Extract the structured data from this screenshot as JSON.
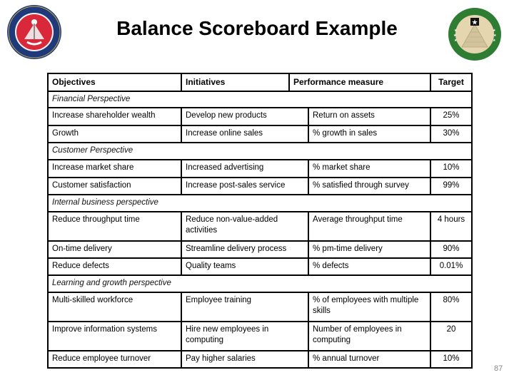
{
  "slide": {
    "title": "Balance Scoreboard Example",
    "page_number": "87",
    "left_logo": "office-of-the-assistant-secretary-of-the-army-seal",
    "right_logo": "united-states-army-financial-management-seal"
  },
  "colors": {
    "left_seal_outer": "#1f3a7a",
    "left_seal_inner": "#d8283a",
    "right_seal_outer": "#2e7d32",
    "right_seal_inner": "#e6d6b0"
  },
  "table": {
    "headers": {
      "objectives": "Objectives",
      "initiatives": "Initiatives",
      "performance_measure": "Performance measure",
      "target": "Target"
    },
    "sections": [
      {
        "title": "Financial Perspective",
        "rows": [
          {
            "objective": "Increase shareholder wealth",
            "initiative": "Develop new products",
            "measure": "Return on assets",
            "target": "25%"
          },
          {
            "objective": "Growth",
            "initiative": "Increase online sales",
            "measure": "% growth in sales",
            "target": "30%"
          }
        ]
      },
      {
        "title": "Customer Perspective",
        "rows": [
          {
            "objective": "Increase market share",
            "initiative": "Increased advertising",
            "measure": "% market share",
            "target": "10%"
          },
          {
            "objective": "Customer satisfaction",
            "initiative": "Increase post-sales service",
            "measure": "% satisfied through survey",
            "target": "99%"
          }
        ]
      },
      {
        "title": "Internal business perspective",
        "rows": [
          {
            "objective": "Reduce throughput time",
            "initiative": "Reduce non-value-added activities",
            "measure": "Average throughput time",
            "target": "4 hours"
          },
          {
            "objective": "On-time delivery",
            "initiative": "Streamline delivery process",
            "measure": "% pm-time delivery",
            "target": "90%"
          },
          {
            "objective": "Reduce defects",
            "initiative": "Quality teams",
            "measure": "% defects",
            "target": "0.01%"
          }
        ]
      },
      {
        "title": "Learning and growth perspective",
        "rows": [
          {
            "objective": "Multi-skilled workforce",
            "initiative": "Employee training",
            "measure": "% of employees with multiple skills",
            "target": "80%"
          },
          {
            "objective": "Improve information systems",
            "initiative": "Hire new employees in computing",
            "measure": "Number of employees in computing",
            "target": "20"
          },
          {
            "objective": "Reduce employee turnover",
            "initiative": "Pay higher salaries",
            "measure": "% annual turnover",
            "target": "10%"
          }
        ]
      }
    ]
  }
}
